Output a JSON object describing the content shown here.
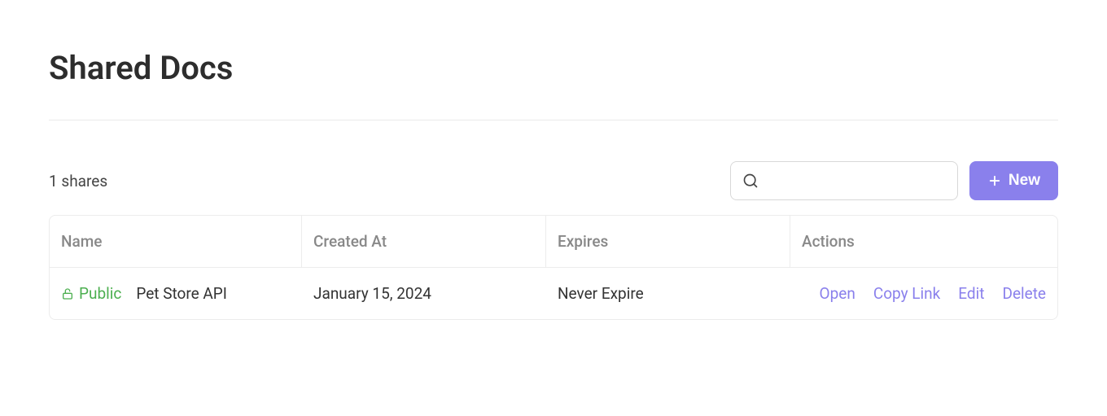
{
  "page": {
    "title": "Shared Docs",
    "shares_count_text": "1 shares"
  },
  "toolbar": {
    "search_placeholder": "",
    "new_button_label": "New"
  },
  "table": {
    "headers": {
      "name": "Name",
      "created_at": "Created At",
      "expires": "Expires",
      "actions": "Actions"
    },
    "rows": [
      {
        "visibility": "Public",
        "name": "Pet Store API",
        "created_at": "January 15, 2024",
        "expires": "Never Expire",
        "actions": {
          "open": "Open",
          "copy_link": "Copy Link",
          "edit": "Edit",
          "delete": "Delete"
        }
      }
    ]
  }
}
